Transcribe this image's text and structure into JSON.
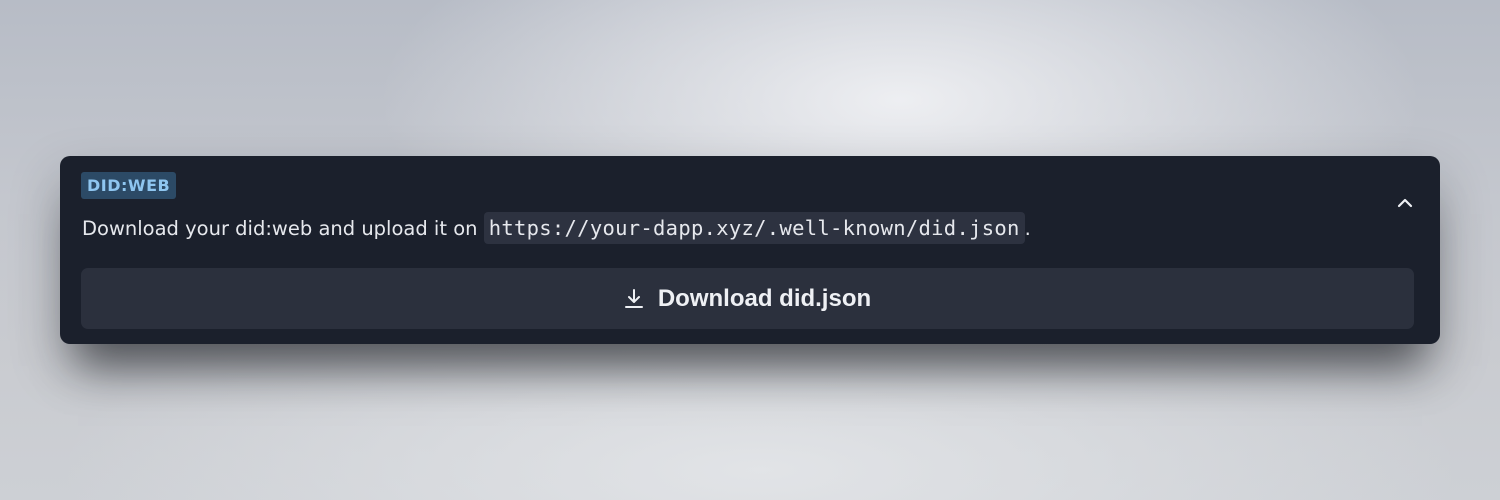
{
  "card": {
    "badge": "DID:WEB",
    "description_prefix": "Download your did:web and upload it on",
    "description_url": "https://your-dapp.xyz/.well-known/did.json",
    "description_suffix": ".",
    "collapse_icon": "chevron-up-icon",
    "download_button": {
      "label": "Download did.json",
      "icon": "download-icon"
    }
  },
  "colors": {
    "card_background": "#1b202c",
    "badge_background": "#2c4a66",
    "badge_text": "#8fc6f0",
    "code_background": "#2d3240",
    "button_background": "#2b303d",
    "text": "#e6e8ed"
  }
}
